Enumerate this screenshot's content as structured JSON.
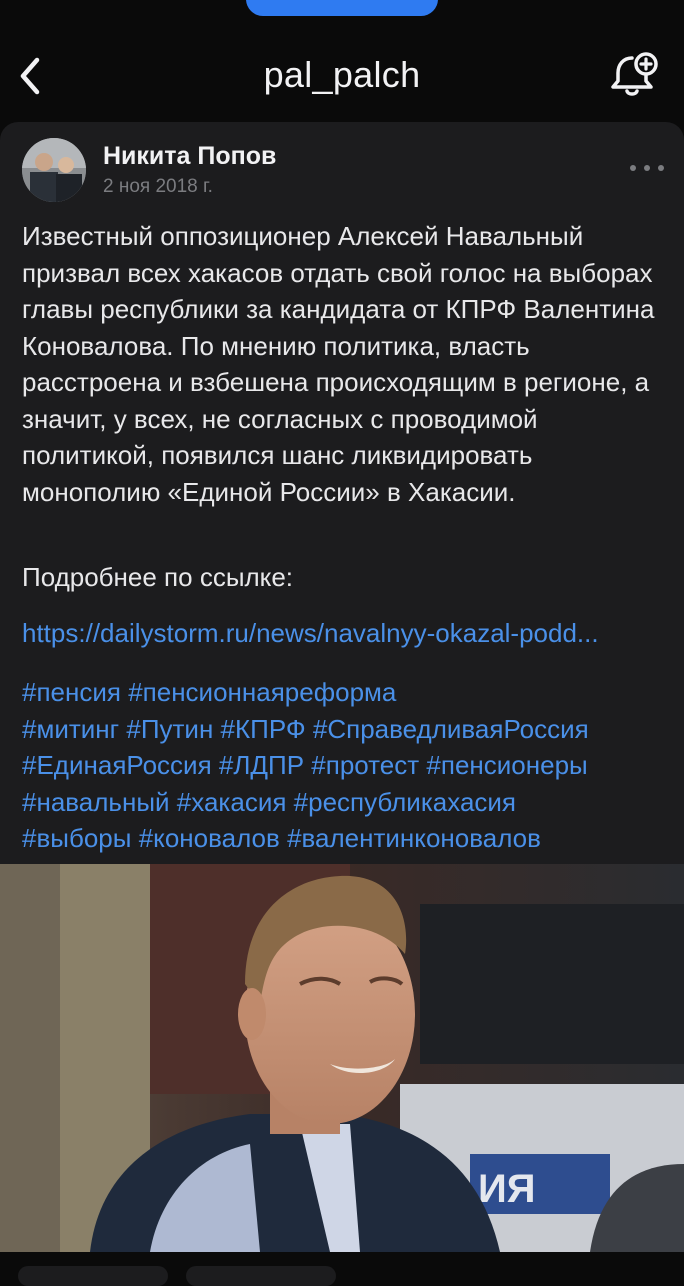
{
  "header": {
    "title": "pal_palch",
    "back_icon": "chevron-left-icon",
    "bell_icon": "bell-plus-icon"
  },
  "post": {
    "author": "Никита Попов",
    "date": "2 ноя 2018 г.",
    "text": "Известный оппозиционер Алексей Навальный призвал всех хакасов отдать свой голос на выборах главы республики за кандидата от КПРФ Валентина Коновалова. По мнению политика, власть расстроена и взбешена происходящим в регионе, а значит, у всех, не согласных с проводимой политикой, появился шанс ликвидировать монополию «Единой России» в Хакасии.",
    "more_label": "Подробнее по ссылке:",
    "link": "https://dailystorm.ru/news/navalnyy-okazal-podd...",
    "tags": [
      "#пенсия",
      "#пенсионнаяреформа",
      "#митинг",
      "#Путин",
      "#КПРФ",
      "#СправедливаяРоссия",
      "#ЕдинаяРоссия",
      "#ЛДПР",
      "#протест",
      "#пенсионеры",
      "#навальный",
      "#хакасия",
      "#республикахасия",
      "#выборы",
      "#коновалов",
      "#валентинконовалов"
    ]
  },
  "colors": {
    "background": "#0a0a0a",
    "card": "#1c1c1e",
    "link": "#4a90e8",
    "accent_pill": "#2f7bf1"
  }
}
